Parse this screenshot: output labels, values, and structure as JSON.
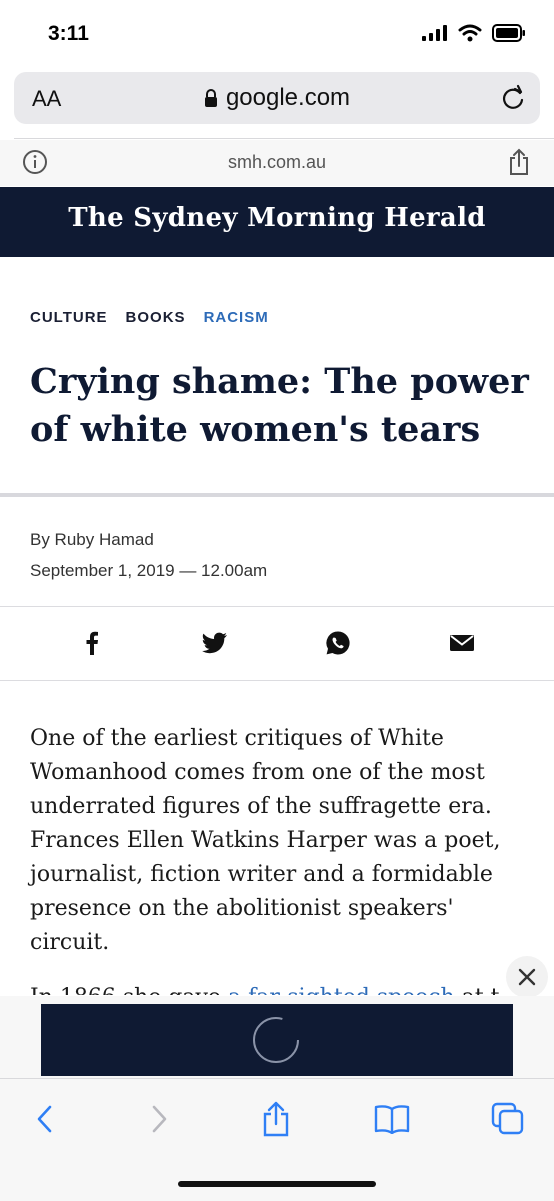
{
  "status_bar": {
    "time": "3:11"
  },
  "browser": {
    "text_size_label": "AA",
    "url": "google.com",
    "site_domain": "smh.com.au"
  },
  "masthead": {
    "title": "The Sydney Morning Herald"
  },
  "article": {
    "tags": [
      {
        "label": "CULTURE",
        "accent": false
      },
      {
        "label": "BOOKS",
        "accent": false
      },
      {
        "label": "RACISM",
        "accent": true
      }
    ],
    "headline": "Crying shame: The power of white women's tears",
    "byline": "By Ruby Hamad",
    "date": "September 1, 2019 — 12.00am",
    "paragraph_1": "One of the earliest critiques of White Womanhood comes from one of the most underrated figures of the suffragette era. Frances Ellen Watkins Harper was a poet, journalist, fiction writer and a formidable presence on the abolitionist speakers' circuit.",
    "paragraph_2_start": "In 1866 she gave ",
    "paragraph_2_link": "a far-sighted speech",
    "paragraph_2_end": " at the"
  },
  "share": [
    "facebook-icon",
    "twitter-icon",
    "whatsapp-icon",
    "email-icon"
  ],
  "colors": {
    "masthead_bg": "#0f1a33",
    "accent": "#2d6bb8"
  }
}
